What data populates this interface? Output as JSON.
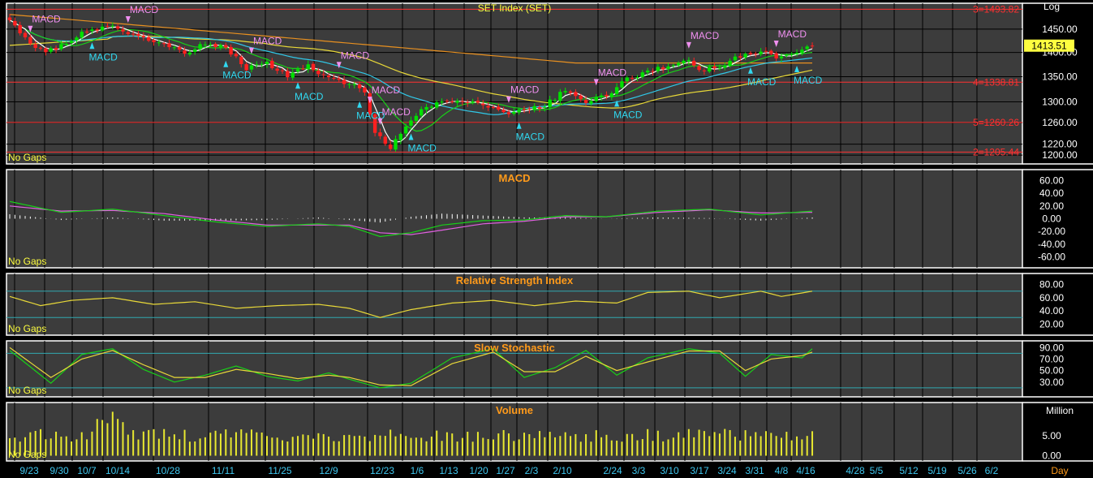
{
  "colors": {
    "background": "#000000",
    "panel": "#3c3c3c",
    "grid": "#000000",
    "frame": "#ffffff",
    "up_candle": "#00e000",
    "down_candle": "#ff2020",
    "ma_fast": "#ffffff",
    "ma_green": "#18d018",
    "ma_cyan": "#30c8e8",
    "ma_yellow": "#e8d838",
    "ma_orange": "#e89020",
    "fib_line": "#ff3030",
    "axis_text": "#ffffff",
    "date_text": "#40c8f0",
    "panel_title": "#ff9a1a",
    "volume": "#e8e830",
    "macd_buy": "#30d8f0",
    "macd_sell": "#f090f0",
    "ref_line": "#30a8b0"
  },
  "price_panel": {
    "title": "SET Index (SET)",
    "scale_label": "Log",
    "no_gaps": "No Gaps",
    "last_price": "1413.51",
    "y_ticks": [
      "1450.00",
      "1400.00",
      "1350.00",
      "1300.00",
      "1260.00",
      "1220.00",
      "1200.00"
    ],
    "fib_levels": [
      {
        "label": "3=1493.82",
        "value": 1493.82
      },
      {
        "label": "4=1338.81",
        "value": 1338.81
      },
      {
        "label": "5=1260.26",
        "value": 1260.26
      },
      {
        "label": "2=1205.44",
        "value": 1205.44
      }
    ],
    "signal_text": "MACD"
  },
  "macd_panel": {
    "title": "MACD",
    "no_gaps": "No Gaps",
    "y_ticks": [
      "60.00",
      "40.00",
      "20.00",
      "0.00",
      "-20.00",
      "-40.00",
      "-60.00"
    ]
  },
  "rsi_panel": {
    "title": "Relative Strength Index",
    "no_gaps": "No Gaps",
    "y_ticks": [
      "80.00",
      "60.00",
      "40.00",
      "20.00"
    ]
  },
  "stoch_panel": {
    "title": "Slow Stochastic",
    "no_gaps": "No Gaps",
    "y_ticks": [
      "90.00",
      "70.00",
      "50.00",
      "30.00"
    ]
  },
  "volume_panel": {
    "title": "Volume",
    "no_gaps": "No Gaps",
    "unit": "Million",
    "y_ticks": [
      "5.00",
      "0.00"
    ]
  },
  "x_axis": {
    "labels": [
      "9/23",
      "9/30",
      "10/7",
      "10/14",
      "10/28",
      "11/11",
      "11/25",
      "12/9",
      "12/23",
      "1/6",
      "1/13",
      "1/20",
      "1/27",
      "2/3",
      "2/10",
      "2/24",
      "3/3",
      "3/10",
      "3/17",
      "3/24",
      "3/31",
      "4/8",
      "4/16",
      "4/28",
      "5/5",
      "5/12",
      "5/19",
      "5/26",
      "6/2"
    ],
    "unit": "Day"
  },
  "chart_data": {
    "type": "candlestick",
    "scale": "log",
    "ylim": [
      1190,
      1500
    ],
    "close_keypoints": [
      [
        0,
        1468
      ],
      [
        4,
        1418
      ],
      [
        7,
        1400
      ],
      [
        10,
        1415
      ],
      [
        14,
        1440
      ],
      [
        19,
        1458
      ],
      [
        22,
        1446
      ],
      [
        26,
        1430
      ],
      [
        30,
        1415
      ],
      [
        34,
        1398
      ],
      [
        38,
        1420
      ],
      [
        42,
        1410
      ],
      [
        46,
        1368
      ],
      [
        50,
        1378
      ],
      [
        54,
        1350
      ],
      [
        58,
        1372
      ],
      [
        62,
        1345
      ],
      [
        66,
        1338
      ],
      [
        69,
        1318
      ],
      [
        71,
        1240
      ],
      [
        74,
        1215
      ],
      [
        77,
        1250
      ],
      [
        80,
        1285
      ],
      [
        84,
        1298
      ],
      [
        88,
        1302
      ],
      [
        92,
        1296
      ],
      [
        96,
        1278
      ],
      [
        100,
        1285
      ],
      [
        104,
        1292
      ],
      [
        108,
        1325
      ],
      [
        112,
        1300
      ],
      [
        116,
        1312
      ],
      [
        120,
        1345
      ],
      [
        124,
        1360
      ],
      [
        128,
        1372
      ],
      [
        132,
        1380
      ],
      [
        135,
        1362
      ],
      [
        138,
        1372
      ],
      [
        142,
        1392
      ],
      [
        146,
        1402
      ],
      [
        150,
        1388
      ],
      [
        154,
        1402
      ],
      [
        156,
        1413.51
      ]
    ],
    "signals": [
      {
        "idx": 4,
        "type": "sell"
      },
      {
        "idx": 16,
        "type": "buy"
      },
      {
        "idx": 23,
        "type": "sell"
      },
      {
        "idx": 42,
        "type": "buy"
      },
      {
        "idx": 47,
        "type": "sell"
      },
      {
        "idx": 56,
        "type": "buy"
      },
      {
        "idx": 64,
        "type": "sell"
      },
      {
        "idx": 68,
        "type": "buy"
      },
      {
        "idx": 70,
        "type": "sell"
      },
      {
        "idx": 72,
        "type": "sell"
      },
      {
        "idx": 78,
        "type": "buy"
      },
      {
        "idx": 97,
        "type": "sell"
      },
      {
        "idx": 99,
        "type": "buy"
      },
      {
        "idx": 114,
        "type": "sell"
      },
      {
        "idx": 118,
        "type": "buy"
      },
      {
        "idx": 132,
        "type": "sell"
      },
      {
        "idx": 144,
        "type": "buy"
      },
      {
        "idx": 149,
        "type": "sell"
      },
      {
        "idx": 153,
        "type": "buy"
      }
    ],
    "macd_keypoints": [
      [
        0,
        27
      ],
      [
        10,
        10
      ],
      [
        20,
        15
      ],
      [
        30,
        5
      ],
      [
        40,
        -5
      ],
      [
        50,
        -12
      ],
      [
        60,
        -8
      ],
      [
        66,
        -12
      ],
      [
        72,
        -28
      ],
      [
        78,
        -22
      ],
      [
        84,
        -10
      ],
      [
        92,
        -3
      ],
      [
        100,
        -2
      ],
      [
        108,
        5
      ],
      [
        116,
        3
      ],
      [
        126,
        12
      ],
      [
        136,
        15
      ],
      [
        146,
        6
      ],
      [
        156,
        12
      ]
    ],
    "signal_keypoints": [
      [
        0,
        20
      ],
      [
        10,
        12
      ],
      [
        20,
        13
      ],
      [
        30,
        8
      ],
      [
        40,
        -2
      ],
      [
        50,
        -10
      ],
      [
        60,
        -10
      ],
      [
        66,
        -10
      ],
      [
        72,
        -22
      ],
      [
        78,
        -25
      ],
      [
        84,
        -18
      ],
      [
        92,
        -8
      ],
      [
        100,
        -4
      ],
      [
        108,
        3
      ],
      [
        116,
        3
      ],
      [
        126,
        10
      ],
      [
        136,
        14
      ],
      [
        146,
        9
      ],
      [
        156,
        10
      ]
    ],
    "rsi_keypoints": [
      [
        0,
        62
      ],
      [
        6,
        48
      ],
      [
        12,
        56
      ],
      [
        20,
        60
      ],
      [
        28,
        50
      ],
      [
        36,
        54
      ],
      [
        44,
        44
      ],
      [
        52,
        48
      ],
      [
        60,
        50
      ],
      [
        66,
        44
      ],
      [
        72,
        30
      ],
      [
        78,
        42
      ],
      [
        86,
        52
      ],
      [
        94,
        56
      ],
      [
        102,
        48
      ],
      [
        110,
        55
      ],
      [
        118,
        52
      ],
      [
        124,
        68
      ],
      [
        132,
        70
      ],
      [
        138,
        60
      ],
      [
        146,
        70
      ],
      [
        150,
        62
      ],
      [
        156,
        70
      ]
    ],
    "stoch_k_keypoints": [
      [
        0,
        85
      ],
      [
        8,
        28
      ],
      [
        14,
        78
      ],
      [
        20,
        88
      ],
      [
        26,
        52
      ],
      [
        32,
        30
      ],
      [
        38,
        42
      ],
      [
        44,
        58
      ],
      [
        50,
        40
      ],
      [
        56,
        32
      ],
      [
        62,
        46
      ],
      [
        66,
        35
      ],
      [
        72,
        20
      ],
      [
        78,
        28
      ],
      [
        86,
        72
      ],
      [
        94,
        88
      ],
      [
        100,
        38
      ],
      [
        106,
        55
      ],
      [
        112,
        85
      ],
      [
        118,
        42
      ],
      [
        124,
        72
      ],
      [
        132,
        88
      ],
      [
        138,
        80
      ],
      [
        143,
        40
      ],
      [
        148,
        78
      ],
      [
        154,
        72
      ],
      [
        156,
        88
      ]
    ],
    "stoch_d_keypoints": [
      [
        0,
        90
      ],
      [
        8,
        38
      ],
      [
        14,
        70
      ],
      [
        20,
        85
      ],
      [
        26,
        60
      ],
      [
        32,
        38
      ],
      [
        38,
        38
      ],
      [
        44,
        52
      ],
      [
        50,
        45
      ],
      [
        56,
        36
      ],
      [
        62,
        42
      ],
      [
        66,
        38
      ],
      [
        72,
        25
      ],
      [
        78,
        24
      ],
      [
        86,
        62
      ],
      [
        94,
        82
      ],
      [
        100,
        48
      ],
      [
        106,
        48
      ],
      [
        112,
        75
      ],
      [
        118,
        50
      ],
      [
        124,
        65
      ],
      [
        132,
        84
      ],
      [
        138,
        84
      ],
      [
        143,
        50
      ],
      [
        148,
        70
      ],
      [
        154,
        76
      ],
      [
        156,
        82
      ]
    ]
  }
}
